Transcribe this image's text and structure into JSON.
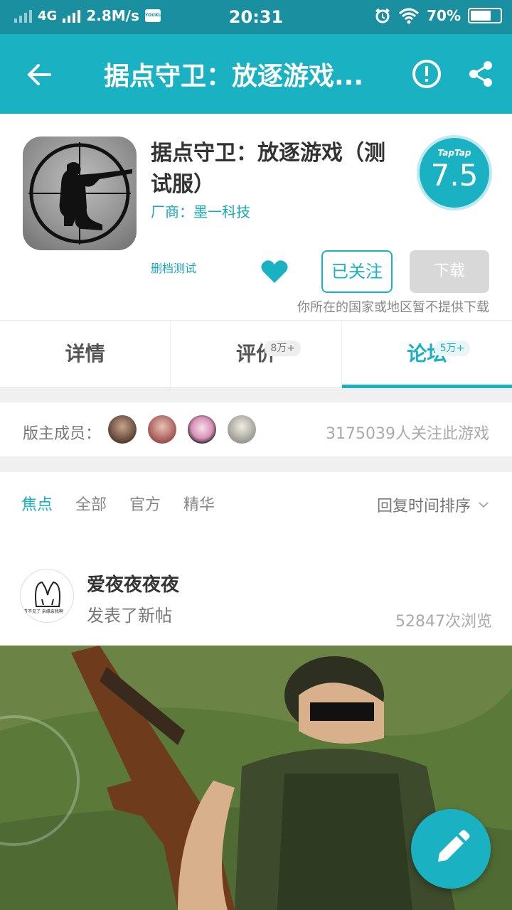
{
  "status_bar": {
    "network": "4G",
    "speed": "2.8M/s",
    "app_badge": "YOUKU",
    "time": "20:31",
    "battery": "70%",
    "battery_level": 0.7
  },
  "header": {
    "title": "据点守卫：放逐游戏..."
  },
  "app": {
    "name": "据点守卫：放逐游戏（测试服）",
    "vendor": "厂商：墨一科技",
    "score_brand": "TapTap",
    "score": "7.5",
    "tag": "删档测试",
    "follow_label": "已关注",
    "download_label": "下载",
    "region_note": "你所在的国家或地区暂不提供下载"
  },
  "tabs": [
    {
      "label": "详情",
      "badge": ""
    },
    {
      "label": "评价",
      "badge": "8万+"
    },
    {
      "label": "论坛",
      "badge": "5万+"
    }
  ],
  "forum": {
    "moderators_label": "版主成员：",
    "followers": "3175039人关注此游戏",
    "filters": [
      "焦点",
      "全部",
      "官方",
      "精华"
    ],
    "sort_label": "回复时间排序"
  },
  "post": {
    "user": "爱夜夜夜夜",
    "avatar_caption": "看不见了 亲缘亲我啊",
    "action": "发表了新帖",
    "views": "52847次浏览"
  },
  "colors": {
    "accent": "#1ab1c2",
    "status_bar": "#1a8fa0"
  }
}
